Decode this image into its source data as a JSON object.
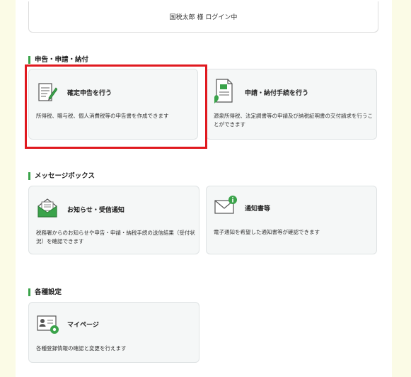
{
  "login": {
    "status": "国税太郎 様 ログイン中"
  },
  "sections": {
    "filing": {
      "title": "申告・申請・納付",
      "cards": [
        {
          "title": "確定申告を行う",
          "desc": "所得税、贈与税、個人消費税等の申告書を作成できます",
          "icon": "document-edit-icon"
        },
        {
          "title": "申請・納付手続を行う",
          "desc": "源泉所得税、法定調書等の申請及び納税証明書の交付請求を行うことができます",
          "icon": "certificate-icon"
        }
      ]
    },
    "messages": {
      "title": "メッセージボックス",
      "cards": [
        {
          "title": "お知らせ・受信通知",
          "desc": "税務署からのお知らせや申告・申請・納税手続の送信結果（受付状況）を確認できます",
          "icon": "open-mail-icon"
        },
        {
          "title": "通知書等",
          "desc": "電子通知を希望した通知書等が確認できます",
          "icon": "mail-info-icon"
        }
      ]
    },
    "settings": {
      "title": "各種設定",
      "cards": [
        {
          "title": "マイページ",
          "desc": "各種登録情報の確認と変更を行えます",
          "icon": "profile-settings-icon"
        }
      ]
    }
  },
  "colors": {
    "accent": "#3aa34a",
    "highlight": "#e0191f",
    "background": "#fbfbe6",
    "card": "#f5f7f7"
  }
}
